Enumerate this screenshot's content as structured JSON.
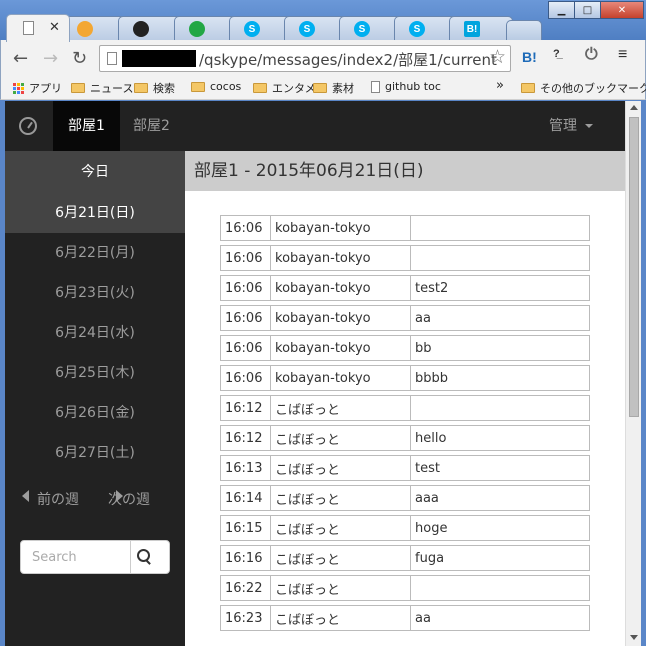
{
  "browser": {
    "tabs": [
      {
        "icon": "blank-page-icon",
        "active": true
      },
      {
        "icon": "orange-circle-icon"
      },
      {
        "icon": "github-icon"
      },
      {
        "icon": "green-app-icon"
      },
      {
        "icon": "skype-icon"
      },
      {
        "icon": "skype-icon"
      },
      {
        "icon": "skype-icon"
      },
      {
        "icon": "skype-icon"
      },
      {
        "icon": "hatena-bookmark-icon"
      }
    ],
    "url": "/qskype/messages/index2/部屋1/current",
    "bookmark_button": "B!",
    "bookmarks": [
      "アプリ",
      "ニュース",
      "検索",
      "cocos",
      "エンタメ",
      "素材",
      "github toc"
    ],
    "bookmarks_more": "»",
    "other_bookmarks": "その他のブックマーク"
  },
  "navbar": {
    "rooms": [
      "部屋1",
      "部屋2"
    ],
    "admin_label": "管理"
  },
  "sidebar": {
    "today_label": "今日",
    "days": [
      "6月21日(日)",
      "6月22日(月)",
      "6月23日(火)",
      "6月24日(水)",
      "6月25日(木)",
      "6月26日(金)",
      "6月27日(土)"
    ],
    "prev_week": "前の週",
    "next_week": "次の週",
    "search_placeholder": "Search"
  },
  "main": {
    "heading": "部屋1 - 2015年06月21日(日)",
    "messages": [
      {
        "time": "16:06",
        "user": "kobayan-tokyo",
        "text": ""
      },
      {
        "time": "16:06",
        "user": "kobayan-tokyo",
        "text": ""
      },
      {
        "time": "16:06",
        "user": "kobayan-tokyo",
        "text": "test2"
      },
      {
        "time": "16:06",
        "user": "kobayan-tokyo",
        "text": "aa"
      },
      {
        "time": "16:06",
        "user": "kobayan-tokyo",
        "text": "bb"
      },
      {
        "time": "16:06",
        "user": "kobayan-tokyo",
        "text": "bbbb"
      },
      {
        "time": "16:12",
        "user": "こばぼっと",
        "text": ""
      },
      {
        "time": "16:12",
        "user": "こばぼっと",
        "text": "hello"
      },
      {
        "time": "16:13",
        "user": "こばぼっと",
        "text": "test"
      },
      {
        "time": "16:14",
        "user": "こばぼっと",
        "text": "aaa"
      },
      {
        "time": "16:15",
        "user": "こばぼっと",
        "text": "hoge"
      },
      {
        "time": "16:16",
        "user": "こばぼっと",
        "text": "fuga"
      },
      {
        "time": "16:22",
        "user": "こばぼっと",
        "text": ""
      },
      {
        "time": "16:23",
        "user": "こばぼっと",
        "text": "aa"
      }
    ]
  }
}
